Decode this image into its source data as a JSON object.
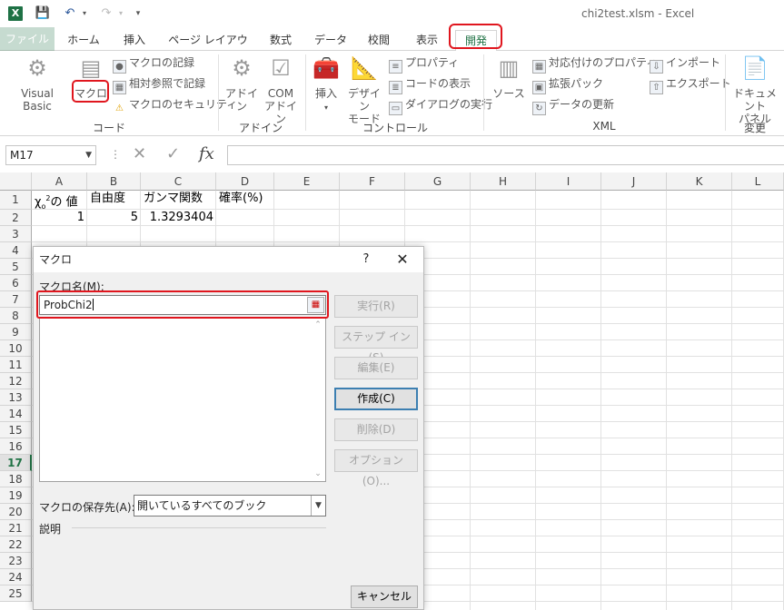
{
  "window": {
    "title": "chi2test.xlsm - Excel",
    "app_icon": "X"
  },
  "quick_access": {
    "save": "💾",
    "undo": "↶",
    "redo": "↷",
    "customize": "▾"
  },
  "tabs": [
    {
      "label": "ファイル"
    },
    {
      "label": "ホーム"
    },
    {
      "label": "挿入"
    },
    {
      "label": "ページ レイアウト"
    },
    {
      "label": "数式"
    },
    {
      "label": "データ"
    },
    {
      "label": "校閲"
    },
    {
      "label": "表示"
    },
    {
      "label": "開発"
    }
  ],
  "ribbon": {
    "code": {
      "group_label": "コード",
      "visual_basic": "Visual Basic",
      "macro": "マクロ",
      "record_macro": "マクロの記録",
      "relative_ref": "相対参照で記録",
      "macro_security": "マクロのセキュリティ"
    },
    "addins": {
      "group_label": "アドイン",
      "addins": "アドイン",
      "com_addins_1": "COM",
      "com_addins_2": "アドイン"
    },
    "controls": {
      "group_label": "コントロール",
      "insert": "挿入",
      "design_mode_1": "デザイン",
      "design_mode_2": "モード",
      "properties": "プロパティ",
      "view_code": "コードの表示",
      "run_dialog": "ダイアログの実行"
    },
    "xml": {
      "group_label": "XML",
      "source": "ソース",
      "map_properties": "対応付けのプロパティ",
      "expansion_packs": "拡張パック",
      "refresh_data": "データの更新",
      "import": "インポート",
      "export": "エクスポート"
    },
    "modify": {
      "group_label": "変更",
      "doc_panel_1": "ドキュメント",
      "doc_panel_2": "パネル"
    }
  },
  "formula_bar": {
    "name_box": "M17",
    "cancel": "✕",
    "enter": "✓",
    "fx": "fx",
    "value": ""
  },
  "columns": [
    "A",
    "B",
    "C",
    "D",
    "E",
    "F",
    "G",
    "H",
    "I",
    "J",
    "K",
    "L"
  ],
  "rows": [
    "1",
    "2",
    "3",
    "4",
    "5",
    "6",
    "7",
    "8",
    "9",
    "10",
    "11",
    "12",
    "13",
    "14",
    "15",
    "16",
    "17",
    "18",
    "19",
    "20",
    "21",
    "22",
    "23",
    "24",
    "25"
  ],
  "cells": {
    "A1": "χ",
    "A1_sub": "o",
    "A1_sup": "2",
    "A1_rest": "の 値",
    "B1": "自由度",
    "C1": "ガンマ関数",
    "D1": "確率(%)",
    "A2": "1",
    "B2": "5",
    "C2": "1.3293404"
  },
  "dialog": {
    "title": "マクロ",
    "help": "?",
    "close": "✕",
    "macro_name_label": "マクロ名(M):",
    "macro_name_value": "ProbChi2",
    "buttons": {
      "run": "実行(R)",
      "step_into": "ステップ イン(S)",
      "edit": "編集(E)",
      "create": "作成(C)",
      "delete": "削除(D)",
      "options": "オプション(O)...",
      "cancel": "キャンセル"
    },
    "store_label": "マクロの保存先(A):",
    "store_value": "開いているすべてのブック",
    "description_label": "説明"
  },
  "colors": {
    "accent": "#217346",
    "highlight": "#e0161e"
  }
}
